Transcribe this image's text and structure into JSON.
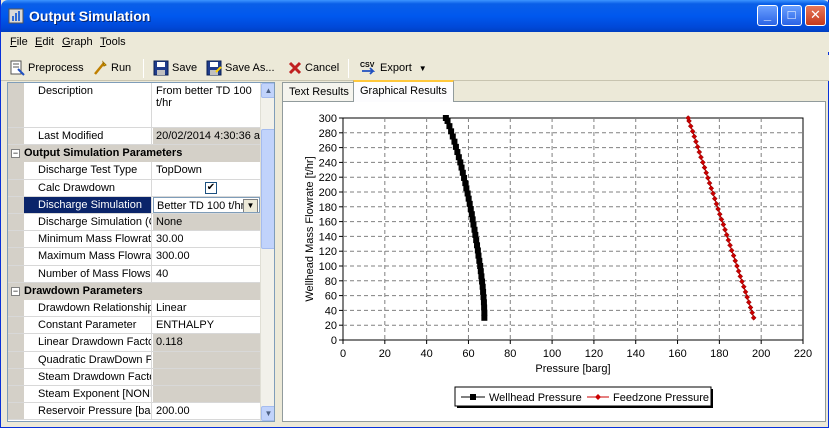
{
  "window": {
    "title": "Output Simulation",
    "buttons": [
      "_",
      "□",
      "✕"
    ]
  },
  "menu": [
    {
      "label": "File",
      "underline": "F",
      "rest": "ile"
    },
    {
      "label": "Edit",
      "underline": "E",
      "rest": "dit"
    },
    {
      "label": "Graph",
      "underline": "G",
      "rest": "raph"
    },
    {
      "label": "Tools",
      "underline": "T",
      "rest": "ools"
    }
  ],
  "toolbar": {
    "preprocess": "Preprocess",
    "run": "Run",
    "save": "Save",
    "save_as": "Save As...",
    "cancel": "Cancel",
    "export": "Export",
    "export_icon_text": "CSV"
  },
  "properties": {
    "rows": [
      {
        "type": "prop",
        "name": "Description",
        "value": "From better TD 100",
        "value2": "t/hr",
        "grey": false,
        "tall": true
      },
      {
        "type": "prop",
        "name": "Last Modified",
        "value": "20/02/2014 4:30:36 a",
        "grey": true
      },
      {
        "type": "cat",
        "label": "Output Simulation Parameters"
      },
      {
        "type": "prop",
        "name": "Discharge Test Type",
        "value": "TopDown",
        "grey": false
      },
      {
        "type": "check",
        "name": "Calc Drawdown",
        "checked": true
      },
      {
        "type": "select",
        "name": "Discharge Simulation",
        "value": "Better TD 100 t/hr"
      },
      {
        "type": "prop",
        "name": "Discharge Simulation (C",
        "value": "None",
        "grey": true
      },
      {
        "type": "prop",
        "name": "Minimum Mass Flowrate",
        "value": "30.00",
        "grey": false
      },
      {
        "type": "prop",
        "name": "Maximum Mass Flowrate",
        "value": "300.00",
        "grey": false
      },
      {
        "type": "prop",
        "name": "Number of Mass Flows",
        "value": "40",
        "grey": false
      },
      {
        "type": "cat",
        "label": "Drawdown Parameters"
      },
      {
        "type": "prop",
        "name": "Drawdown Relationship",
        "value": "Linear",
        "grey": false
      },
      {
        "type": "prop",
        "name": "Constant Parameter",
        "value": "ENTHALPY",
        "grey": false
      },
      {
        "type": "prop",
        "name": "Linear Drawdown Facto",
        "value": "0.118",
        "grey": true
      },
      {
        "type": "prop",
        "name": "Quadratic DrawDown F",
        "value": "",
        "grey": true
      },
      {
        "type": "prop",
        "name": "Steam Drawdown Facto",
        "value": "",
        "grey": true
      },
      {
        "type": "prop",
        "name": "Steam Exponent [NONI",
        "value": "",
        "grey": true
      },
      {
        "type": "prop",
        "name": "Reservoir Pressure [ba",
        "value": "200.00",
        "grey": false
      }
    ]
  },
  "tabs": [
    {
      "label": "Text Results",
      "active": false
    },
    {
      "label": "Graphical Results",
      "active": true
    }
  ],
  "chart_data": {
    "type": "line",
    "title": "",
    "xlabel": "Pressure [barg]",
    "ylabel": "Wellhead Mass Flowrate [t/hr]",
    "xlim": [
      0,
      220
    ],
    "ylim": [
      0,
      300
    ],
    "xticks": [
      0,
      20,
      40,
      60,
      80,
      100,
      120,
      140,
      160,
      180,
      200,
      220
    ],
    "yticks": [
      0,
      20,
      40,
      60,
      80,
      100,
      120,
      140,
      160,
      180,
      200,
      220,
      240,
      260,
      280,
      300
    ],
    "grid": true,
    "legend": "bottom",
    "series": [
      {
        "name": "Wellhead Pressure",
        "color": "#000000",
        "marker": "square",
        "points": [
          [
            67.6,
            30
          ],
          [
            67.6,
            37
          ],
          [
            67.5,
            44
          ],
          [
            67.4,
            51
          ],
          [
            67.2,
            58
          ],
          [
            67.0,
            65
          ],
          [
            66.8,
            72
          ],
          [
            66.5,
            79
          ],
          [
            66.2,
            86
          ],
          [
            65.9,
            93
          ],
          [
            65.6,
            100
          ],
          [
            65.2,
            107
          ],
          [
            64.8,
            114
          ],
          [
            64.5,
            121
          ],
          [
            64.1,
            128
          ],
          [
            63.7,
            135
          ],
          [
            63.3,
            142
          ],
          [
            62.9,
            149
          ],
          [
            62.4,
            156
          ],
          [
            62.0,
            163
          ],
          [
            61.6,
            170
          ],
          [
            61.1,
            177
          ],
          [
            60.6,
            184
          ],
          [
            60.1,
            191
          ],
          [
            59.6,
            198
          ],
          [
            59.0,
            205
          ],
          [
            58.5,
            212
          ],
          [
            57.9,
            219
          ],
          [
            57.3,
            226
          ],
          [
            56.7,
            233
          ],
          [
            56.1,
            240
          ],
          [
            55.4,
            247
          ],
          [
            54.7,
            254
          ],
          [
            54.0,
            261
          ],
          [
            53.3,
            268
          ],
          [
            52.5,
            275
          ],
          [
            51.7,
            282
          ],
          [
            50.9,
            289
          ],
          [
            50.0,
            296
          ],
          [
            49.2,
            300
          ]
        ]
      },
      {
        "name": "Feedzone Pressure",
        "color": "#cc0000",
        "marker": "diamond",
        "points": [
          [
            196.4,
            30
          ],
          [
            195.7,
            37
          ],
          [
            194.9,
            44
          ],
          [
            194.1,
            51
          ],
          [
            193.3,
            58
          ],
          [
            192.5,
            65
          ],
          [
            191.7,
            72
          ],
          [
            190.8,
            79
          ],
          [
            190.0,
            86
          ],
          [
            189.2,
            93
          ],
          [
            188.4,
            100
          ],
          [
            187.6,
            107
          ],
          [
            186.8,
            114
          ],
          [
            185.9,
            121
          ],
          [
            185.1,
            128
          ],
          [
            184.3,
            135
          ],
          [
            183.5,
            142
          ],
          [
            182.7,
            149
          ],
          [
            181.9,
            156
          ],
          [
            181.0,
            163
          ],
          [
            180.2,
            170
          ],
          [
            179.4,
            177
          ],
          [
            178.6,
            184
          ],
          [
            177.8,
            191
          ],
          [
            177.0,
            198
          ],
          [
            176.1,
            205
          ],
          [
            175.3,
            212
          ],
          [
            174.5,
            219
          ],
          [
            173.7,
            226
          ],
          [
            172.9,
            233
          ],
          [
            172.1,
            240
          ],
          [
            171.2,
            247
          ],
          [
            170.4,
            254
          ],
          [
            169.6,
            261
          ],
          [
            168.8,
            268
          ],
          [
            168.0,
            275
          ],
          [
            167.2,
            282
          ],
          [
            166.3,
            289
          ],
          [
            165.5,
            296
          ],
          [
            165.1,
            300
          ]
        ]
      }
    ]
  }
}
